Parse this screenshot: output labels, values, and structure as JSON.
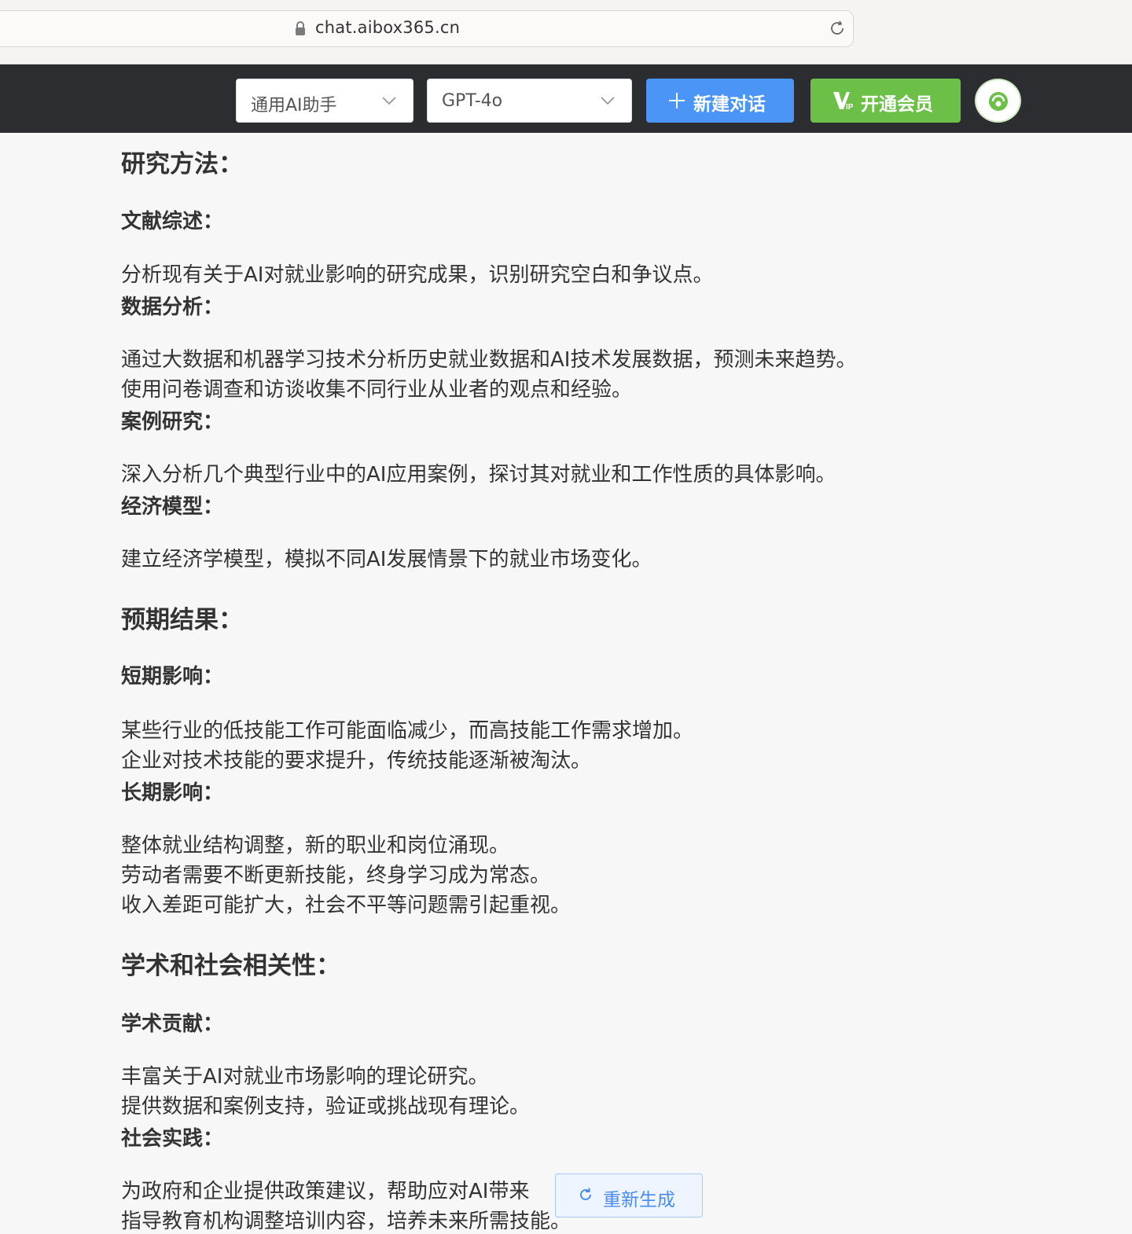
{
  "browser": {
    "url": "chat.aibox365.cn"
  },
  "header": {
    "assistant_select": "通用AI助手",
    "model_select": "GPT-4o",
    "new_chat_label": "新建对话",
    "vip_label": "开通会员"
  },
  "article": {
    "methods": {
      "title": "研究方法：",
      "lit_title": "文献综述：",
      "lit_text": "分析现有关于AI对就业影响的研究成果，识别研究空白和争议点。",
      "data_title": "数据分析：",
      "data_text_1": "通过大数据和机器学习技术分析历史就业数据和AI技术发展数据，预测未来趋势。",
      "data_text_2": "使用问卷调查和访谈收集不同行业从业者的观点和经验。",
      "case_title": "案例研究：",
      "case_text": "深入分析几个典型行业中的AI应用案例，探讨其对就业和工作性质的具体影响。",
      "model_title": "经济模型：",
      "model_text": "建立经济学模型，模拟不同AI发展情景下的就业市场变化。"
    },
    "results": {
      "title": "预期结果：",
      "short_title": "短期影响：",
      "short_text_1": "某些行业的低技能工作可能面临减少，而高技能工作需求增加。",
      "short_text_2": "企业对技术技能的要求提升，传统技能逐渐被淘汰。",
      "long_title": "长期影响：",
      "long_text_1": "整体就业结构调整，新的职业和岗位涌现。",
      "long_text_2": "劳动者需要不断更新技能，终身学习成为常态。",
      "long_text_3": "收入差距可能扩大，社会不平等问题需引起重视。"
    },
    "relevance": {
      "title": "学术和社会相关性：",
      "academic_title": "学术贡献：",
      "academic_text_1": "丰富关于AI对就业市场影响的理论研究。",
      "academic_text_2": "提供数据和案例支持，验证或挑战现有理论。",
      "social_title": "社会实践：",
      "social_text_1": "为政府和企业提供政策建议，帮助应对AI带来",
      "social_text_2": "指导教育机构调整培训内容，培养未来所需技能。"
    }
  },
  "regenerate_label": "重新生成",
  "colors": {
    "header_bg": "#2b2d30",
    "primary_blue": "#4a95f6",
    "vip_green": "#6cbf47"
  }
}
